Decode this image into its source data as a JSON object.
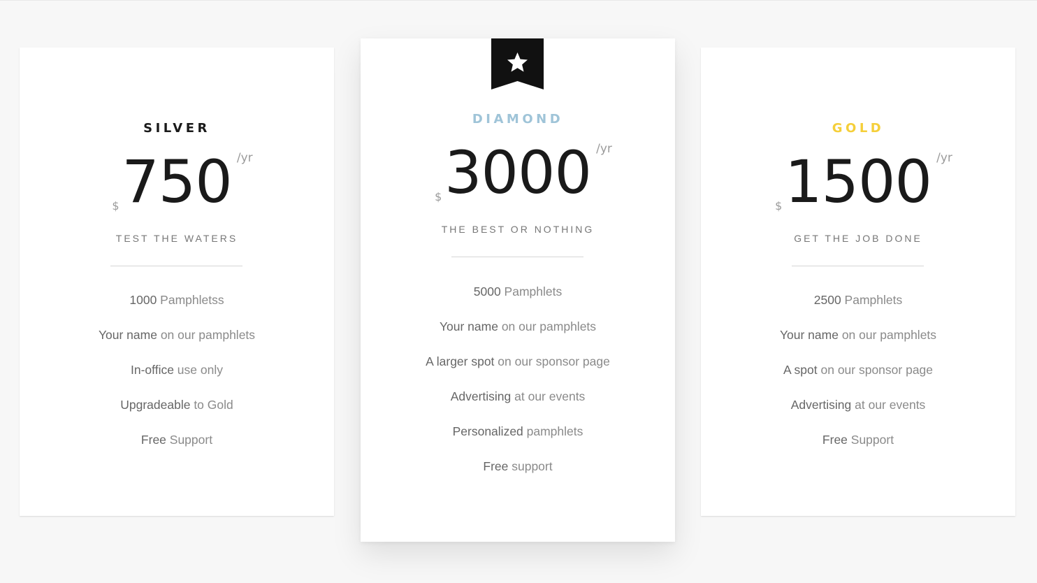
{
  "colors": {
    "page_background": "#f7f7f7",
    "card_background": "#ffffff",
    "silver_title": "#1a1a1a",
    "diamond_title": "#9fc4d8",
    "gold_title": "#f5cf3a",
    "ribbon": "#111111"
  },
  "plans": [
    {
      "name": "SILVER",
      "currency": "$",
      "price": "750",
      "period": "/yr",
      "tagline": "TEST THE WATERS",
      "featured": false,
      "features": [
        {
          "strong": "1000",
          "rest": " Pamphletss"
        },
        {
          "strong": "Your name",
          "rest": " on our pamphlets"
        },
        {
          "strong": "In-office",
          "rest": " use only"
        },
        {
          "strong": "Upgradeable",
          "rest": " to Gold"
        },
        {
          "strong": "Free",
          "rest": " Support"
        }
      ]
    },
    {
      "name": "DIAMOND",
      "currency": "$",
      "price": "3000",
      "period": "/yr",
      "tagline": "THE BEST OR NOTHING",
      "featured": true,
      "ribbon_icon": "star-icon",
      "features": [
        {
          "strong": "5000",
          "rest": " Pamphlets"
        },
        {
          "strong": "Your name",
          "rest": " on our pamphlets"
        },
        {
          "strong": "A larger spot",
          "rest": " on our sponsor page"
        },
        {
          "strong": "Advertising",
          "rest": " at our events"
        },
        {
          "strong": "Personalized",
          "rest": " pamphlets"
        },
        {
          "strong": "Free",
          "rest": " support"
        }
      ]
    },
    {
      "name": "GOLD",
      "currency": "$",
      "price": "1500",
      "period": "/yr",
      "tagline": "GET THE JOB DONE",
      "featured": false,
      "features": [
        {
          "strong": "2500",
          "rest": " Pamphlets"
        },
        {
          "strong": "Your name",
          "rest": " on our pamphlets"
        },
        {
          "strong": "A spot",
          "rest": " on our sponsor page"
        },
        {
          "strong": "Advertising",
          "rest": " at our events"
        },
        {
          "strong": "Free",
          "rest": " Support"
        }
      ]
    }
  ]
}
